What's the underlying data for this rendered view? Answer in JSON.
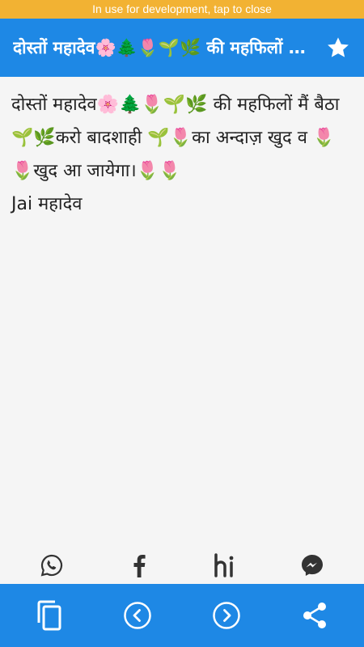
{
  "dev_banner": {
    "text": "In use for development, tap to close"
  },
  "app_bar": {
    "title": "दोस्तों महादेव🌸🌲🌷🌱🌿 की महफिलों मैं बैठा 🌱🌿करो बादशाही 🌱🌷का अन्दाज़ खुद व 🌷🌷खुद आ जायेगा।🌷🌷",
    "favorite_icon": "star-icon"
  },
  "message": {
    "text": "दोस्तों महादेव🌸🌲🌷🌱🌿 की महफिलों मैं बैठा 🌱🌿करो बादशाही 🌱🌷का अन्दाज़ खुद व 🌷🌷खुद आ जायेगा।🌷🌷\nJai महादेव"
  },
  "share_row": {
    "items": [
      {
        "icon": "whatsapp-icon"
      },
      {
        "icon": "facebook-icon"
      },
      {
        "icon": "hike-icon",
        "label": "hi"
      },
      {
        "icon": "messenger-icon"
      }
    ]
  },
  "bottom_bar": {
    "items": [
      {
        "icon": "copy-icon"
      },
      {
        "icon": "previous-icon"
      },
      {
        "icon": "next-icon"
      },
      {
        "icon": "share-icon"
      }
    ]
  },
  "colors": {
    "primary": "#1e88e5",
    "banner": "#f2b233",
    "background": "#f5f5f5",
    "text": "#222222"
  }
}
